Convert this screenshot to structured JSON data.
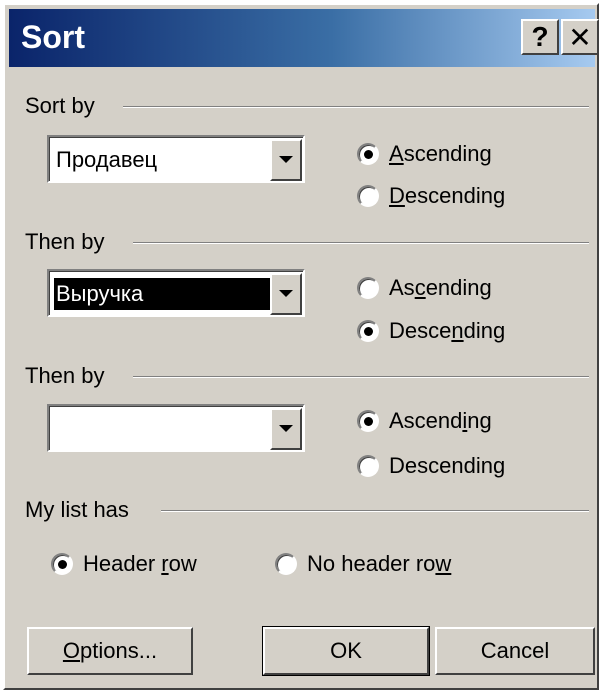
{
  "window": {
    "title": "Sort",
    "help_glyph": "?",
    "close_glyph": "✕"
  },
  "sort_by": {
    "label": "Sort by",
    "value": "Продавец",
    "ascending": {
      "pre": "",
      "key": "A",
      "post": "scending",
      "checked": true
    },
    "descending": {
      "pre": "",
      "key": "D",
      "post": "escending",
      "checked": false
    }
  },
  "then_by_1": {
    "label": "Then by",
    "value": "Выручка",
    "highlighted": true,
    "ascending": {
      "pre": "As",
      "key": "c",
      "post": "ending",
      "checked": false
    },
    "descending": {
      "pre": "Desce",
      "key": "n",
      "post": "ding",
      "checked": true
    }
  },
  "then_by_2": {
    "label": "Then by",
    "value": "",
    "ascending": {
      "pre": "Ascend",
      "key": "i",
      "post": "ng",
      "checked": true
    },
    "descending": {
      "pre": "Descendin",
      "key": "g",
      "post": "",
      "checked": false
    }
  },
  "list_has": {
    "label": "My list has",
    "header_row": {
      "pre": "Header ",
      "key": "r",
      "post": "ow",
      "checked": true
    },
    "no_header_row": {
      "pre": "No header ro",
      "key": "w",
      "post": "",
      "checked": false
    }
  },
  "buttons": {
    "options": {
      "pre": "",
      "key": "O",
      "post": "ptions..."
    },
    "ok": "OK",
    "cancel": "Cancel"
  },
  "icons": {
    "help": "help-icon",
    "close": "close-icon",
    "dropdown": "chevron-down-icon"
  }
}
